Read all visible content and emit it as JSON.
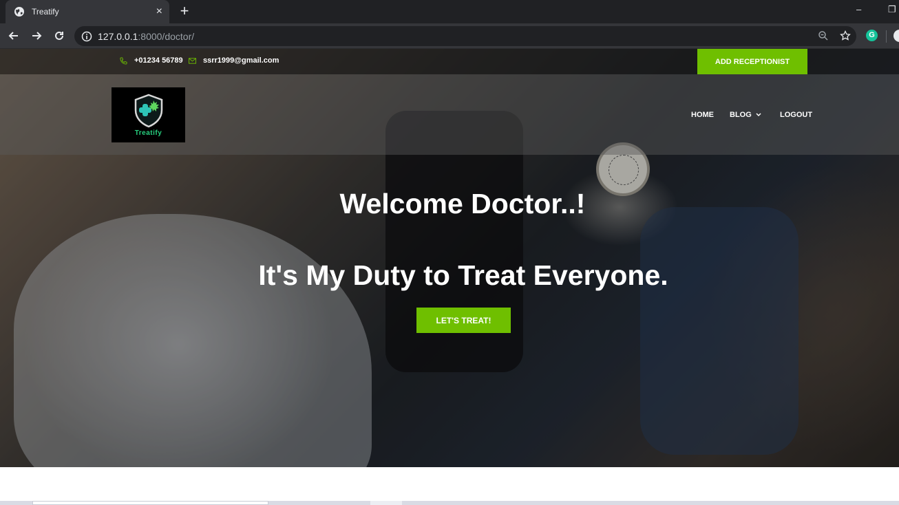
{
  "browser": {
    "tab_title": "Treatify",
    "tab_close": "×",
    "new_tab": "+",
    "url_host": "127.0.0.1",
    "url_path": ":8000/doctor/",
    "window_minimize": "–",
    "window_restore": "❐",
    "grammarly_letter": "G"
  },
  "topbar": {
    "phone": "+01234 56789",
    "email": "ssrr1999@gmail.com",
    "add_receptionist": "ADD RECEPTIONIST"
  },
  "header": {
    "logo_text": "Treatify",
    "nav": {
      "home": "HOME",
      "blog": "BLOG",
      "logout": "LOGOUT"
    }
  },
  "hero": {
    "welcome": "Welcome Doctor..!",
    "tagline": "It's My Duty to Treat Everyone.",
    "cta": "LET'S TREAT!"
  },
  "colors": {
    "accent": "#6fbf00",
    "browser_tab_bg": "#35363a",
    "browser_frame": "#202124"
  }
}
